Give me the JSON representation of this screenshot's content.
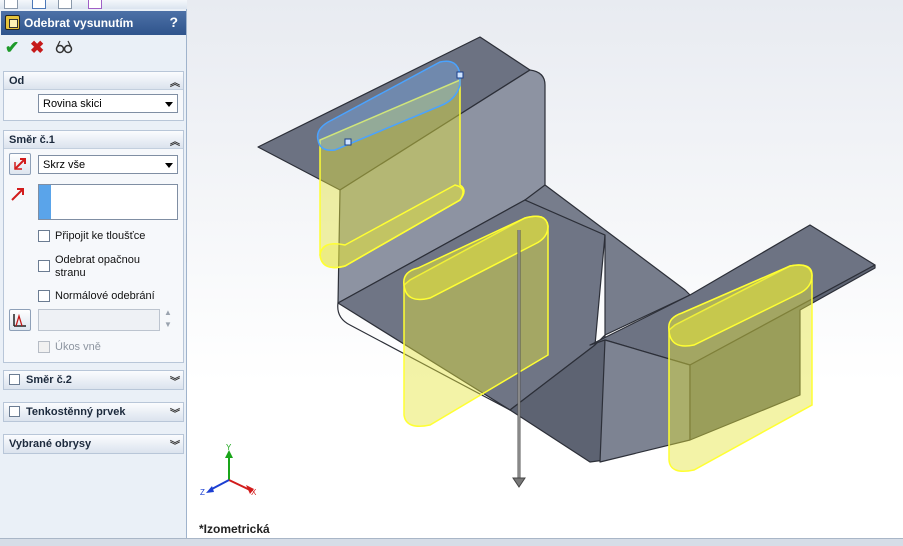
{
  "title": "Odebrat vysunutím",
  "help": "?",
  "actions": {
    "ok": "✔",
    "cancel": "✖",
    "preview": "👓"
  },
  "section_od": {
    "label": "Od",
    "select": "Rovina skici"
  },
  "section_dir1": {
    "label": "Směr č.1",
    "end_condition": "Skrz vše",
    "options": [
      {
        "label": "Připojit ke tloušťce",
        "checked": false,
        "enabled": true
      },
      {
        "label_line1": "Odebrat opačnou",
        "label_line2": "stranu",
        "checked": false,
        "enabled": true
      },
      {
        "label": "Normálové odebrání",
        "checked": false,
        "enabled": true
      },
      {
        "label": "Úkos vně",
        "checked": false,
        "enabled": false
      }
    ]
  },
  "section_dir2": {
    "label": "Směr č.2"
  },
  "section_thin": {
    "label": "Tenkostěnný prvek"
  },
  "section_contours": {
    "label": "Vybrané obrysy"
  },
  "view": {
    "label": "*Izometrická"
  },
  "triad": {
    "x": "X",
    "y": "Y",
    "z": "Z"
  },
  "colors": {
    "title_bar": "#3a5f96",
    "preview": "#ffff33",
    "part": "#717888",
    "sketch": "#4aa3ff"
  }
}
